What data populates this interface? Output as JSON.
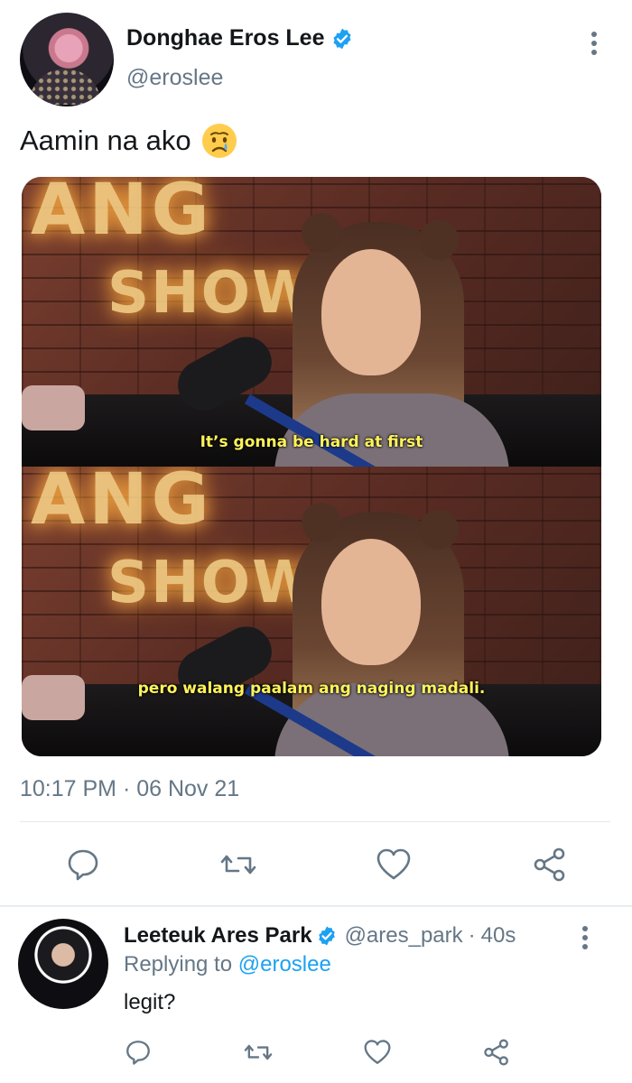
{
  "tweet": {
    "author": {
      "name": "Donghae Eros Lee",
      "handle": "@eroslee",
      "verified": true
    },
    "text": "Aamin na ako",
    "emoji": "crying-face",
    "media": {
      "captions": [
        "It’s gonna be hard at first",
        "pero walang paalam ang naging madali."
      ]
    },
    "timestamp": "10:17 PM · 06 Nov 21",
    "actions": [
      "reply-icon",
      "retweet-icon",
      "like-icon",
      "share-icon"
    ]
  },
  "reply": {
    "author": {
      "name": "Leeteuk Ares Park",
      "handle": "@ares_park",
      "verified": true
    },
    "dot": "·",
    "time": "40s",
    "replying_prefix": "Replying to",
    "replying_to": "@eroslee",
    "text": "legit?"
  },
  "colors": {
    "accent": "#1da1f2",
    "text": "#14171a",
    "secondary": "#657786",
    "divider": "#e1e8ed",
    "caption": "#fff35a"
  }
}
